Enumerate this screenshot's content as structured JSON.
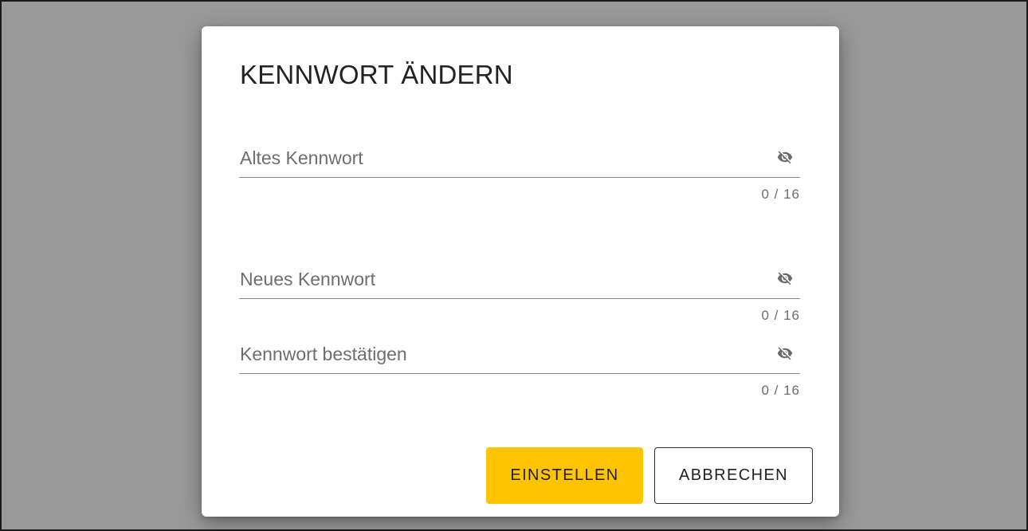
{
  "dialog": {
    "title": "KENNWORT ÄNDERN",
    "fields": [
      {
        "placeholder": "Altes Kennwort",
        "counter": "0 / 16",
        "icon": "eye-off-icon"
      },
      {
        "placeholder": "Neues Kennwort",
        "counter": "0 / 16",
        "icon": "eye-off-icon"
      },
      {
        "placeholder": "Kennwort bestätigen",
        "counter": "0 / 16",
        "icon": "eye-off-icon"
      }
    ],
    "buttons": {
      "confirm_label": "EINSTELLEN",
      "cancel_label": "ABBRECHEN"
    }
  },
  "colors": {
    "backdrop": "#9a9a9a",
    "primary": "#ffc400"
  }
}
